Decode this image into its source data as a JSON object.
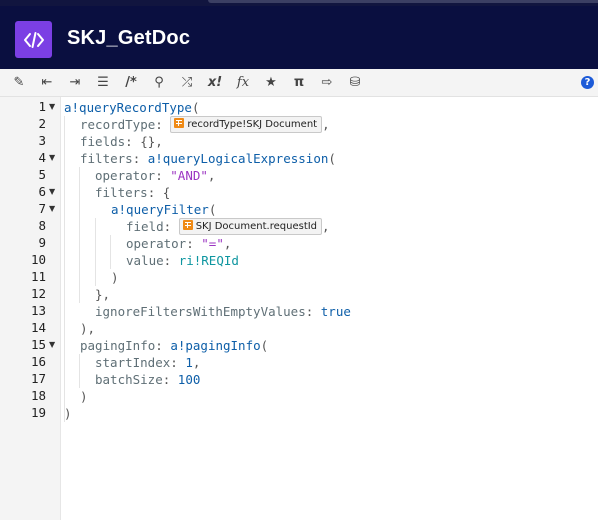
{
  "app": {
    "title": "SKJ_GetDoc"
  },
  "toolbar": {
    "items": [
      {
        "name": "magic-wand-icon",
        "glyph": "✎"
      },
      {
        "name": "outdent-icon",
        "glyph": "⇤"
      },
      {
        "name": "indent-icon",
        "glyph": "⇥"
      },
      {
        "name": "format-lines-icon",
        "glyph": "☰"
      },
      {
        "name": "comment-icon",
        "glyph": "/*"
      },
      {
        "name": "search-icon",
        "glyph": "⚲"
      },
      {
        "name": "shuffle-icon",
        "glyph": "⤮"
      },
      {
        "name": "rule-icon",
        "glyph": "x!"
      },
      {
        "name": "function-icon",
        "glyph": "fx"
      },
      {
        "name": "star-icon",
        "glyph": "★"
      },
      {
        "name": "pi-icon",
        "glyph": "π"
      },
      {
        "name": "export-icon",
        "glyph": "⇨"
      },
      {
        "name": "database-search-icon",
        "glyph": "⛁"
      }
    ],
    "help_glyph": "?"
  },
  "editor": {
    "line_numbers": [
      "1",
      "2",
      "3",
      "4",
      "5",
      "6",
      "7",
      "8",
      "9",
      "10",
      "11",
      "12",
      "13",
      "14",
      "15",
      "16",
      "17",
      "18",
      "19"
    ],
    "tokens": {
      "l1_fn": "a!queryRecordType",
      "l1_p": "(",
      "l2_param": "recordType",
      "l2_colon": ": ",
      "l2_chip": "recordType!SKJ Document",
      "l2_end": ",",
      "l3_param": "fields",
      "l3_rest": ": {},",
      "l4_param": "filters",
      "l4_colon": ": ",
      "l4_fn": "a!queryLogicalExpression",
      "l4_p": "(",
      "l5_param": "operator",
      "l5_colon": ": ",
      "l5_str": "\"AND\"",
      "l5_end": ",",
      "l6_param": "filters",
      "l6_rest": ": {",
      "l7_fn": "a!queryFilter",
      "l7_p": "(",
      "l8_param": "field",
      "l8_colon": ": ",
      "l8_chip": "SKJ Document.requestId",
      "l8_end": ",",
      "l9_param": "operator",
      "l9_colon": ": ",
      "l9_str": "\"=\"",
      "l9_end": ",",
      "l10_param": "value",
      "l10_colon": ": ",
      "l10_ri": "ri!REQId",
      "l11": ")",
      "l12": "},",
      "l13_param": "ignoreFiltersWithEmptyValues",
      "l13_colon": ": ",
      "l13_kw": "true",
      "l14": "),",
      "l15_param": "pagingInfo",
      "l15_colon": ": ",
      "l15_fn": "a!pagingInfo",
      "l15_p": "(",
      "l16_param": "startIndex",
      "l16_colon": ": ",
      "l16_num": "1",
      "l16_end": ",",
      "l17_param": "batchSize",
      "l17_colon": ": ",
      "l17_num": "100",
      "l18": ")",
      "l19": ")"
    }
  }
}
